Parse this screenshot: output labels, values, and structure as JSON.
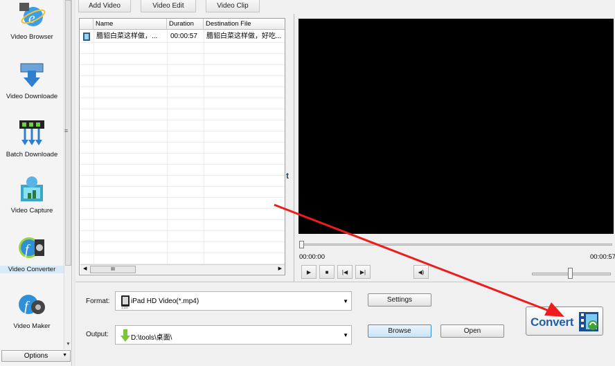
{
  "sidebar": {
    "items": [
      {
        "label": "Video Browser",
        "icon": "video-browser-icon"
      },
      {
        "label": "Video Downloade",
        "icon": "video-download-icon"
      },
      {
        "label": "Batch Downloade",
        "icon": "batch-download-icon"
      },
      {
        "label": "Video Capture",
        "icon": "video-capture-icon"
      },
      {
        "label": "Video Converter",
        "icon": "video-converter-icon",
        "active": true
      },
      {
        "label": "Video Maker",
        "icon": "video-maker-icon"
      }
    ],
    "options_label": "Options"
  },
  "toolbar": {
    "add_video": "Add Video",
    "video_edit": "Video Edit",
    "video_clip": "Video Clip"
  },
  "filelist": {
    "columns": [
      "Name",
      "Duration",
      "Destination File"
    ],
    "rows": [
      {
        "name": "腊貂白菜这样做，...",
        "duration": "00:00:57",
        "destination": "腊貂白菜这样做，好吃..."
      }
    ],
    "scroll_thumb": "III"
  },
  "preview": {
    "time_current": "00:00:00",
    "time_total": "00:00:57",
    "side_letter": "t"
  },
  "format": {
    "label": "Format:",
    "value": "iPad HD Video(*.mp4)",
    "settings_label": "Settings"
  },
  "output": {
    "label": "Output:",
    "value": "D:\\tools\\桌面\\",
    "browse_label": "Browse",
    "open_label": "Open"
  },
  "convert": {
    "label": "Convert"
  },
  "colors": {
    "annotation_arrow": "#ee1c1c",
    "convert_text": "#1f5fa8"
  }
}
